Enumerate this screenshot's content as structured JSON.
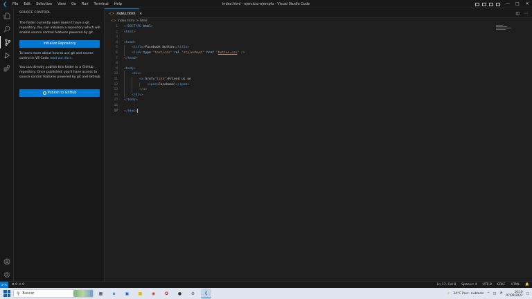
{
  "titlebar": {
    "app_icon": "vscode-logo-icon",
    "menu": [
      "File",
      "Edit",
      "Selection",
      "View",
      "Go",
      "Run",
      "Terminal",
      "Help"
    ],
    "title": "index.html - ejercicio-ejemplo - Visual Studio Code",
    "window_controls": {
      "minimize": "—",
      "maximize": "□",
      "close": "✕"
    }
  },
  "activity_bar": {
    "items": [
      "explorer-icon",
      "search-icon",
      "source-control-icon",
      "run-debug-icon",
      "extensions-icon"
    ],
    "bottom": [
      "accounts-icon",
      "manage-gear-icon"
    ]
  },
  "sidebar": {
    "title": "SOURCE CONTROL",
    "intro": "The folder currently open doesn't have a git repository. You can initialize a repository which will enable source control features powered by git.",
    "init_button": "Initialize Repository",
    "learn_text": "To learn more about how to use git and source control in VS Code ",
    "learn_link": "read our docs",
    "learn_end": ".",
    "publish_text": "You can directly publish this folder to a GitHub repository. Once published, you'll have access to source control features powered by git and GitHub.",
    "publish_button": "Publish to GitHub"
  },
  "editor": {
    "tab": {
      "label": "index.html",
      "close": "✕"
    },
    "breadcrumb": {
      "file": "index.html",
      "sep": ">",
      "symbol": "html"
    },
    "lines": [
      {
        "n": "1",
        "indent": 0,
        "tokens": [
          [
            "punc",
            "<"
          ],
          [
            "tag",
            "!DOCTYPE"
          ],
          [
            "attr",
            " html"
          ],
          [
            "punc",
            ">"
          ]
        ]
      },
      {
        "n": "2",
        "indent": 0,
        "tokens": [
          [
            "punc",
            "<"
          ],
          [
            "tag",
            "html"
          ],
          [
            "punc",
            ">"
          ]
        ]
      },
      {
        "n": "3",
        "indent": 0,
        "tokens": []
      },
      {
        "n": "4",
        "indent": 0,
        "tokens": [
          [
            "punc",
            "<"
          ],
          [
            "tag",
            "head"
          ],
          [
            "punc",
            ">"
          ]
        ]
      },
      {
        "n": "5",
        "indent": 1,
        "tokens": [
          [
            "punc",
            "<"
          ],
          [
            "tag",
            "title"
          ],
          [
            "punc",
            ">"
          ],
          [
            "txt",
            "Facebook button"
          ],
          [
            "punc",
            "</"
          ],
          [
            "tag",
            "title"
          ],
          [
            "punc",
            ">"
          ]
        ]
      },
      {
        "n": "6",
        "indent": 1,
        "tokens": [
          [
            "punc",
            "<"
          ],
          [
            "tag",
            "link"
          ],
          [
            "attr",
            " type"
          ],
          [
            "txt",
            " "
          ],
          [
            "str",
            "\"text/css\""
          ],
          [
            "attr",
            " rel"
          ],
          [
            "txt",
            " "
          ],
          [
            "str",
            "\"stylesheet\""
          ],
          [
            "attr",
            " href"
          ],
          [
            "txt",
            " "
          ],
          [
            "str",
            "\""
          ],
          [
            "link",
            "button.css"
          ],
          [
            "str",
            "\""
          ],
          [
            "punc",
            " />"
          ]
        ]
      },
      {
        "n": "7",
        "indent": 0,
        "tokens": [
          [
            "punc",
            "</"
          ],
          [
            "tag",
            "head"
          ],
          [
            "punc",
            ">"
          ]
        ]
      },
      {
        "n": "8",
        "indent": 0,
        "tokens": []
      },
      {
        "n": "9",
        "indent": 0,
        "tokens": [
          [
            "punc",
            "<"
          ],
          [
            "tag",
            "body"
          ],
          [
            "punc",
            ">"
          ]
        ]
      },
      {
        "n": "10",
        "indent": 1,
        "tokens": [
          [
            "punc",
            "<"
          ],
          [
            "tag",
            "div"
          ],
          [
            "punc",
            ">"
          ]
        ]
      },
      {
        "n": "11",
        "indent": 2,
        "tokens": [
          [
            "punc",
            "<"
          ],
          [
            "tag",
            "a"
          ],
          [
            "attr",
            " href"
          ],
          [
            "txt",
            "="
          ],
          [
            "str",
            "\"link\""
          ],
          [
            "punc",
            ">"
          ],
          [
            "txt",
            "Friend us on"
          ]
        ]
      },
      {
        "n": "12",
        "indent": 3,
        "tokens": [
          [
            "punc",
            "<"
          ],
          [
            "tag",
            "span"
          ],
          [
            "punc",
            ">"
          ],
          [
            "txt",
            "Facebook!"
          ],
          [
            "punc",
            "</"
          ],
          [
            "tag",
            "span"
          ],
          [
            "punc",
            ">"
          ]
        ]
      },
      {
        "n": "13",
        "indent": 2,
        "tokens": [
          [
            "punc",
            "</"
          ],
          [
            "tag",
            "a"
          ],
          [
            "punc",
            ">"
          ]
        ]
      },
      {
        "n": "14",
        "indent": 1,
        "tokens": [
          [
            "punc",
            "</"
          ],
          [
            "tag",
            "div"
          ],
          [
            "punc",
            ">"
          ]
        ]
      },
      {
        "n": "15",
        "indent": 0,
        "tokens": [
          [
            "punc",
            "</"
          ],
          [
            "tag",
            "body"
          ],
          [
            "punc",
            ">"
          ]
        ]
      },
      {
        "n": "16",
        "indent": 0,
        "tokens": []
      },
      {
        "n": "17",
        "indent": 0,
        "tokens": [
          [
            "punc",
            "</"
          ],
          [
            "tag",
            "html"
          ],
          [
            "punc",
            ">"
          ]
        ],
        "cursor": true
      }
    ]
  },
  "statusbar": {
    "problems": "⊗ 0 ⚠ 0",
    "position": "Ln 17, Col 8",
    "spaces": "Spaces: 4",
    "encoding": "UTF-8",
    "eol": "CRLF",
    "language": "HTML"
  },
  "taskbar": {
    "search_placeholder": "Buscar",
    "apps": [
      "file-explorer-icon",
      "edge-icon",
      "store-icon",
      "folder-icon",
      "chrome-icon",
      "opera-icon",
      "app-icon",
      "settings-icon",
      "vscode-icon"
    ],
    "weather": "34°C  Parc. nublado",
    "time": "16:10",
    "date": "07/09/2022"
  },
  "colors": {
    "accent": "#0078d4",
    "editor_bg": "#1e1e1e",
    "sidebar_bg": "#181818"
  }
}
